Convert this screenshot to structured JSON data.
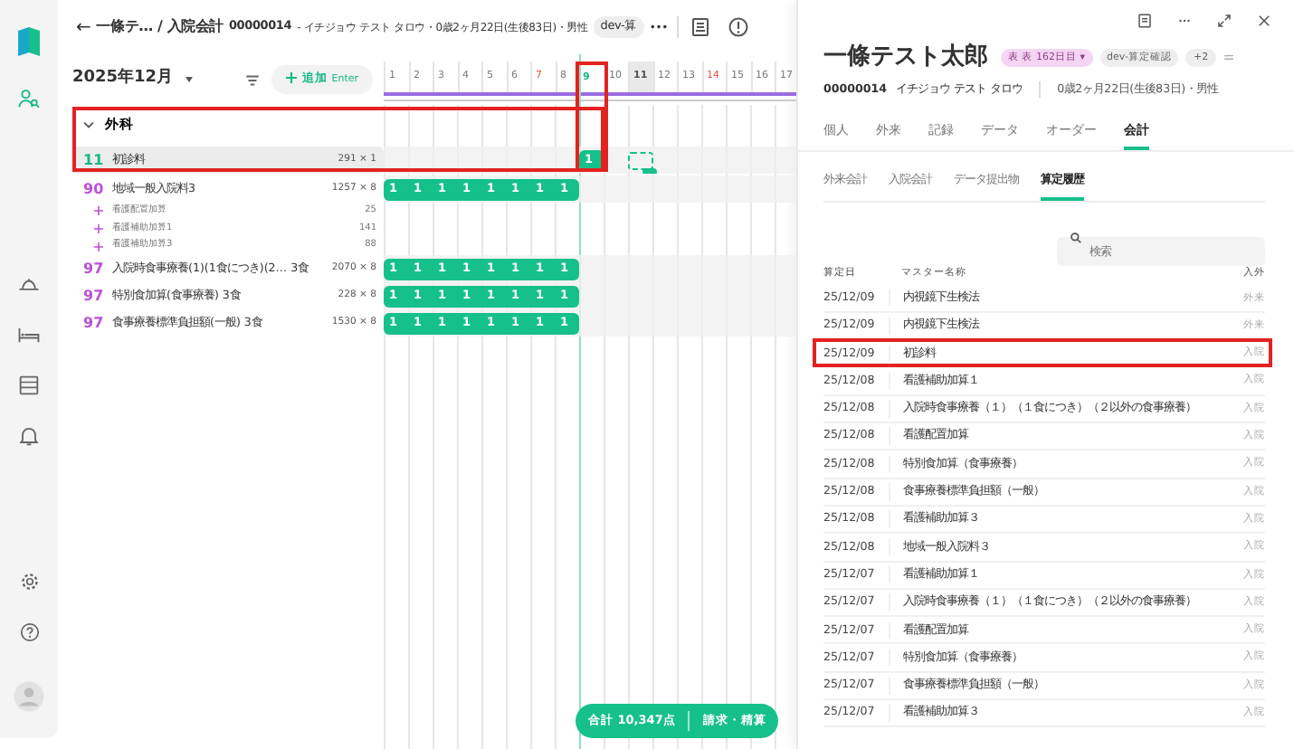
{
  "rail": {
    "items": [
      {
        "selected": true
      },
      {
        "selected": false
      },
      {
        "selected": false
      },
      {
        "selected": false
      },
      {
        "selected": false
      }
    ]
  },
  "header": {
    "back": "←",
    "title": "一條テ… / 入院会計",
    "patient_id": "00000014",
    "patient_info": "- イチジョウ テスト タロウ・0歳2ヶ月22日(生後83日)・男性",
    "tag": "dev-算",
    "more": "•••"
  },
  "toolbar": {
    "month": "2025年12月",
    "add_label": "追加",
    "add_key": "Enter"
  },
  "days": [
    {
      "label": "1",
      "kind": "weekday",
      "highlighted": false
    },
    {
      "label": "2",
      "kind": "weekday",
      "highlighted": false
    },
    {
      "label": "3",
      "kind": "weekday",
      "highlighted": false
    },
    {
      "label": "4",
      "kind": "weekday",
      "highlighted": false
    },
    {
      "label": "5",
      "kind": "weekday",
      "highlighted": false
    },
    {
      "label": "6",
      "kind": "weekday",
      "highlighted": false
    },
    {
      "label": "7",
      "kind": "sunday",
      "highlighted": false
    },
    {
      "label": "8",
      "kind": "weekday",
      "highlighted": false
    },
    {
      "label": "9",
      "kind": "today",
      "highlighted": true
    },
    {
      "label": "10",
      "kind": "weekday",
      "highlighted": false
    },
    {
      "label": "11",
      "kind": "selected",
      "highlighted": false
    },
    {
      "label": "12",
      "kind": "weekday",
      "highlighted": false
    },
    {
      "label": "13",
      "kind": "weekday",
      "highlighted": false
    },
    {
      "label": "14",
      "kind": "sunday",
      "highlighted": false
    },
    {
      "label": "15",
      "kind": "weekday",
      "highlighted": false
    },
    {
      "label": "16",
      "kind": "weekday",
      "highlighted": false
    },
    {
      "label": "17",
      "kind": "weekday",
      "highlighted": false
    }
  ],
  "sections": [
    {
      "title": "外科",
      "expanded": true,
      "highlighted": true,
      "items": [
        {
          "code": "11",
          "color": "#16b886",
          "name": "初診料",
          "amount": "291 × 1",
          "selected": true,
          "daily": [
            {
              "kind": "empty"
            },
            {
              "kind": "empty"
            },
            {
              "kind": "empty"
            },
            {
              "kind": "empty"
            },
            {
              "kind": "empty"
            },
            {
              "kind": "empty"
            },
            {
              "kind": "empty"
            },
            {
              "kind": "empty"
            },
            {
              "kind": "count",
              "text": "1"
            },
            {
              "kind": "empty"
            },
            {
              "kind": "draft"
            }
          ]
        },
        {
          "code": "90",
          "color": "#c04fd8",
          "name": "地域一般入院料3",
          "amount": "1257 × 8",
          "selected": false,
          "daily": [
            {
              "kind": "count",
              "text": "1"
            },
            {
              "kind": "count",
              "text": "1"
            },
            {
              "kind": "count",
              "text": "1"
            },
            {
              "kind": "count",
              "text": "1"
            },
            {
              "kind": "count",
              "text": "1"
            },
            {
              "kind": "count",
              "text": "1"
            },
            {
              "kind": "count",
              "text": "1"
            },
            {
              "kind": "count",
              "text": "1"
            }
          ],
          "children": [
            {
              "name": "看護配置加算",
              "amount": "25"
            },
            {
              "name": "看護補助加算1",
              "amount": "141"
            },
            {
              "name": "看護補助加算3",
              "amount": "88"
            }
          ]
        },
        {
          "code": "97",
          "color": "#c04fd8",
          "name": "入院時食事療養(1)(1食につき)(2… 3食",
          "amount": "2070 × 8",
          "selected": false,
          "daily": [
            {
              "kind": "count",
              "text": "1"
            },
            {
              "kind": "count",
              "text": "1"
            },
            {
              "kind": "count",
              "text": "1"
            },
            {
              "kind": "count",
              "text": "1"
            },
            {
              "kind": "count",
              "text": "1"
            },
            {
              "kind": "count",
              "text": "1"
            },
            {
              "kind": "count",
              "text": "1"
            },
            {
              "kind": "count",
              "text": "1"
            }
          ]
        },
        {
          "code": "97",
          "color": "#c04fd8",
          "name": "特別食加算(食事療養) 3食",
          "amount": "228 × 8",
          "selected": false,
          "daily": [
            {
              "kind": "count",
              "text": "1"
            },
            {
              "kind": "count",
              "text": "1"
            },
            {
              "kind": "count",
              "text": "1"
            },
            {
              "kind": "count",
              "text": "1"
            },
            {
              "kind": "count",
              "text": "1"
            },
            {
              "kind": "count",
              "text": "1"
            },
            {
              "kind": "count",
              "text": "1"
            },
            {
              "kind": "count",
              "text": "1"
            }
          ]
        },
        {
          "code": "97",
          "color": "#c04fd8",
          "name": "食事療養標準負担額(一般) 3食",
          "amount": "1530 × 8",
          "selected": false,
          "daily": [
            {
              "kind": "count",
              "text": "1"
            },
            {
              "kind": "count",
              "text": "1"
            },
            {
              "kind": "count",
              "text": "1"
            },
            {
              "kind": "count",
              "text": "1"
            },
            {
              "kind": "count",
              "text": "1"
            },
            {
              "kind": "count",
              "text": "1"
            },
            {
              "kind": "count",
              "text": "1"
            },
            {
              "kind": "count",
              "text": "1"
            }
          ]
        }
      ]
    }
  ],
  "total_bar": {
    "total": "合計 10,347点",
    "action": "請求・精算"
  },
  "panel": {
    "name": "一條テスト太郎",
    "badges": [
      {
        "text": "表 表 162日目 ▾",
        "kind": "pink"
      },
      {
        "text": "dev-算定確認",
        "kind": "grey"
      },
      {
        "text": "+2",
        "kind": "grey"
      }
    ],
    "patient_id": "00000014",
    "kana": "イチジョウ テスト タロウ",
    "info": "0歳2ヶ月22日(生後83日)・男性",
    "tabs": [
      {
        "label": "個人",
        "selected": false
      },
      {
        "label": "外来",
        "selected": false
      },
      {
        "label": "記録",
        "selected": false
      },
      {
        "label": "データ",
        "selected": false
      },
      {
        "label": "オーダー",
        "selected": false
      },
      {
        "label": "会計",
        "selected": true
      }
    ],
    "subtabs": [
      {
        "label": "外来会計",
        "selected": false
      },
      {
        "label": "入院会計",
        "selected": false
      },
      {
        "label": "データ提出物",
        "selected": false
      },
      {
        "label": "算定履歴",
        "selected": true
      }
    ],
    "search": {
      "placeholder": "検索"
    },
    "table": {
      "columns": [
        "算定日",
        "マスター名称",
        "入外"
      ],
      "rows": [
        {
          "date": "25/12/09",
          "name": "内視鏡下生検法",
          "type": "外来",
          "highlighted": false
        },
        {
          "date": "25/12/09",
          "name": "内視鏡下生検法",
          "type": "外来",
          "highlighted": false
        },
        {
          "date": "25/12/09",
          "name": "初診料",
          "type": "入院",
          "highlighted": true
        },
        {
          "date": "25/12/08",
          "name": "看護補助加算１",
          "type": "入院",
          "highlighted": false
        },
        {
          "date": "25/12/08",
          "name": "入院時食事療養（１）（１食につき）（２以外の食事療養）",
          "type": "入院",
          "highlighted": false
        },
        {
          "date": "25/12/08",
          "name": "看護配置加算",
          "type": "入院",
          "highlighted": false
        },
        {
          "date": "25/12/08",
          "name": "特別食加算（食事療養）",
          "type": "入院",
          "highlighted": false
        },
        {
          "date": "25/12/08",
          "name": "食事療養標準負担額（一般）",
          "type": "入院",
          "highlighted": false
        },
        {
          "date": "25/12/08",
          "name": "看護補助加算３",
          "type": "入院",
          "highlighted": false
        },
        {
          "date": "25/12/08",
          "name": "地域一般入院料３",
          "type": "入院",
          "highlighted": false
        },
        {
          "date": "25/12/07",
          "name": "看護補助加算１",
          "type": "入院",
          "highlighted": false
        },
        {
          "date": "25/12/07",
          "name": "入院時食事療養（１）（１食につき）（２以外の食事療養）",
          "type": "入院",
          "highlighted": false
        },
        {
          "date": "25/12/07",
          "name": "看護配置加算",
          "type": "入院",
          "highlighted": false
        },
        {
          "date": "25/12/07",
          "name": "特別食加算（食事療養）",
          "type": "入院",
          "highlighted": false
        },
        {
          "date": "25/12/07",
          "name": "食事療養標準負担額（一般）",
          "type": "入院",
          "highlighted": false
        },
        {
          "date": "25/12/07",
          "name": "看護補助加算３",
          "type": "入院",
          "highlighted": false
        }
      ]
    }
  }
}
